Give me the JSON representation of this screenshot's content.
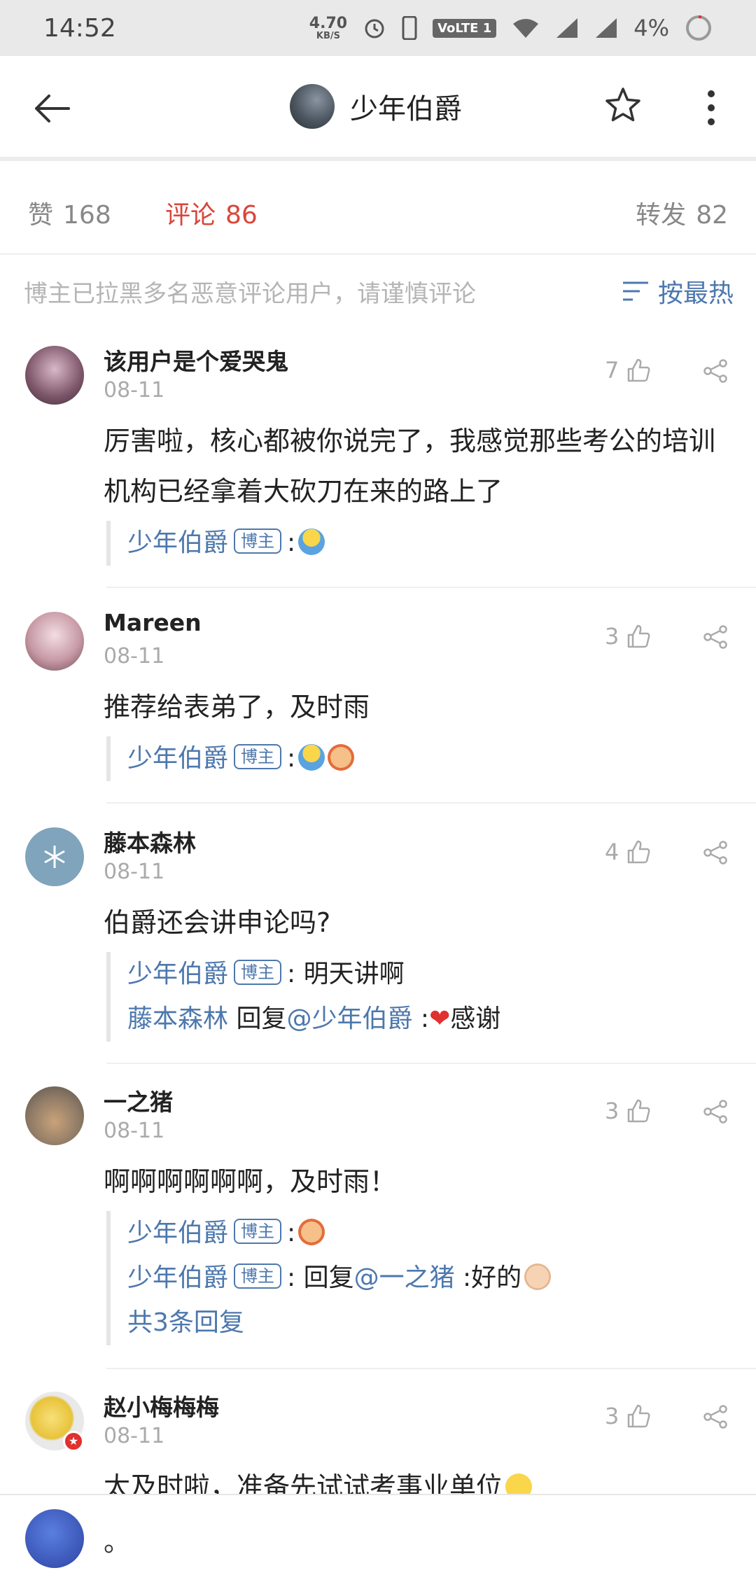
{
  "status": {
    "time": "14:52",
    "speed_value": "4.70",
    "speed_unit": "KB/S",
    "network": "VoLTE 1",
    "battery": "4%"
  },
  "header": {
    "title": "少年伯爵"
  },
  "stats": {
    "likes_label": "赞",
    "likes": "168",
    "comments_label": "评论",
    "comments": "86",
    "reposts_label": "转发",
    "reposts": "82"
  },
  "notice": {
    "text": "博主已拉黑多名恶意评论用户，请谨慎评论",
    "sort_label": "按最热"
  },
  "comments": [
    {
      "name": "该用户是个爱哭鬼",
      "date": "08-11",
      "likes": "7",
      "body": "厉害啦，核心都被你说完了，我感觉那些考公的培训机构已经拿着大砍刀在来的路上了",
      "replies": [
        {
          "author": "少年伯爵",
          "badge": "博主",
          "text": ":"
        }
      ]
    },
    {
      "name": "Mareen",
      "date": "08-11",
      "likes": "3",
      "body": "推荐给表弟了，及时雨",
      "replies": [
        {
          "author": "少年伯爵",
          "badge": "博主",
          "text": ":"
        }
      ]
    },
    {
      "name": "藤本森林",
      "date": "08-11",
      "likes": "4",
      "body": "伯爵还会讲申论吗?",
      "replies": [
        {
          "author": "少年伯爵",
          "badge": "博主",
          "text": ": 明天讲啊"
        },
        {
          "author": "藤本森林",
          "pre": " 回复",
          "mention": "@少年伯爵",
          "text": " :",
          "text2": "感谢"
        }
      ]
    },
    {
      "name": "一之猪",
      "date": "08-11",
      "likes": "3",
      "body": "啊啊啊啊啊啊，及时雨！",
      "replies": [
        {
          "author": "少年伯爵",
          "badge": "博主",
          "text": ":"
        },
        {
          "author": "少年伯爵",
          "badge": "博主",
          "pre": ": 回复",
          "mention": "@一之猪",
          "text": " :好的"
        }
      ],
      "more": "共3条回复"
    },
    {
      "name": "赵小梅梅梅",
      "date": "08-11",
      "likes": "3",
      "body": "太及时啦，准备先试试考事业单位"
    }
  ],
  "input": {
    "value": "。"
  },
  "colors": {
    "accent": "#4d78ad",
    "active_tab": "#d9463a"
  }
}
